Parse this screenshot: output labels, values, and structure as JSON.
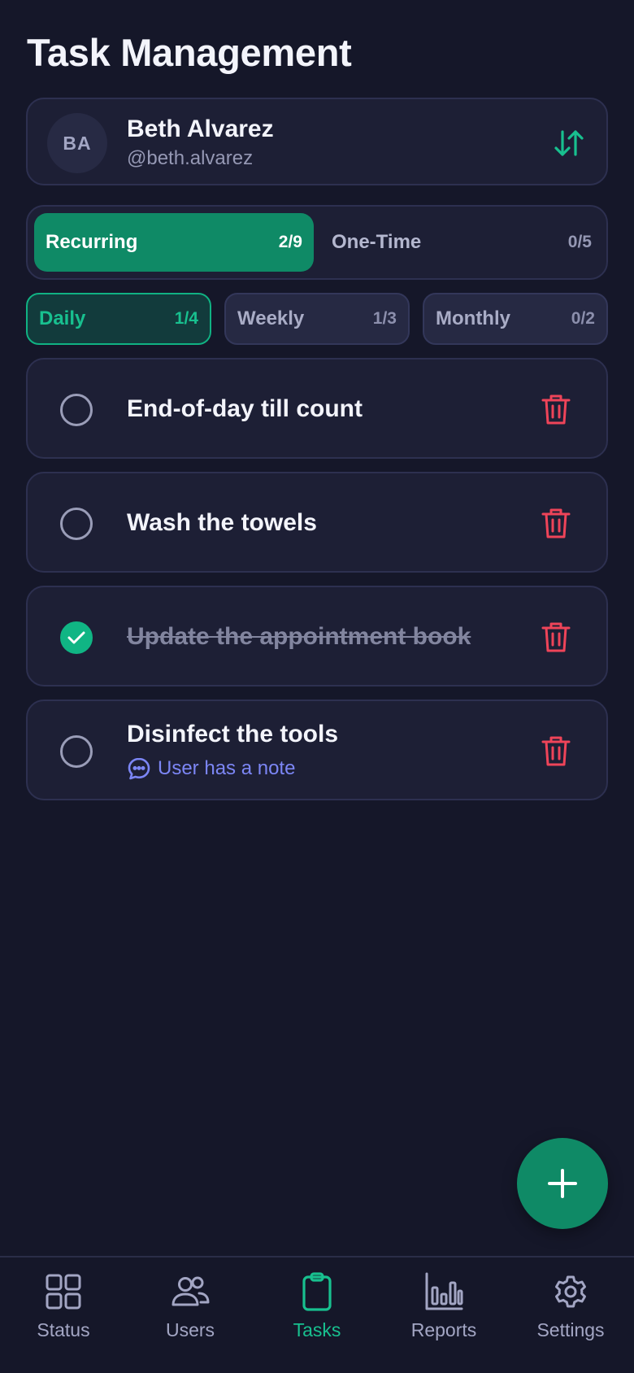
{
  "header": {
    "title": "Task Management"
  },
  "user": {
    "initials": "BA",
    "name": "Beth Alvarez",
    "handle": "@beth.alvarez"
  },
  "segments": [
    {
      "label": "Recurring",
      "count": "2/9",
      "active": true
    },
    {
      "label": "One-Time",
      "count": "0/5",
      "active": false
    }
  ],
  "subtabs": [
    {
      "label": "Daily",
      "count": "1/4",
      "active": true
    },
    {
      "label": "Weekly",
      "count": "1/3",
      "active": false
    },
    {
      "label": "Monthly",
      "count": "0/2",
      "active": false
    }
  ],
  "tasks": [
    {
      "title": "End-of-day till count",
      "done": false
    },
    {
      "title": "Wash the towels",
      "done": false
    },
    {
      "title": "Update the appointment book",
      "done": true
    },
    {
      "title": "Disinfect the tools",
      "done": false,
      "note": "User has a note"
    }
  ],
  "nav": [
    {
      "label": "Status",
      "icon": "grid-icon",
      "active": false
    },
    {
      "label": "Users",
      "icon": "users-icon",
      "active": false
    },
    {
      "label": "Tasks",
      "icon": "clipboard-icon",
      "active": true
    },
    {
      "label": "Reports",
      "icon": "bar-chart-icon",
      "active": false
    },
    {
      "label": "Settings",
      "icon": "gear-icon",
      "active": false
    }
  ],
  "colors": {
    "background": "#151729",
    "card": "#1d1f35",
    "accent": "#0f8a66",
    "accent_light": "#18c08f",
    "danger": "#ef4459",
    "note": "#7c86f5"
  }
}
